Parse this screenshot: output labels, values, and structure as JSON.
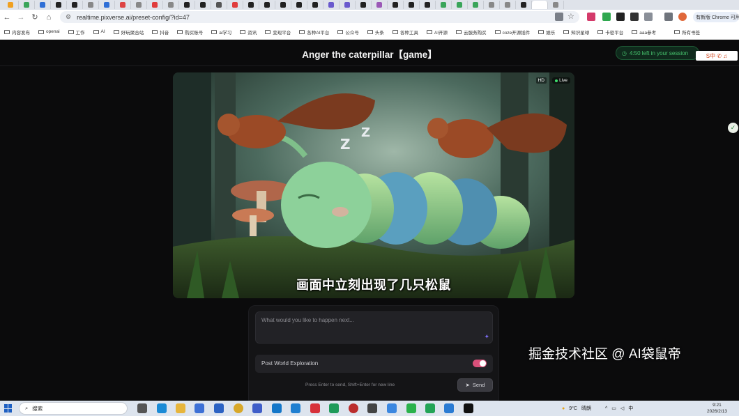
{
  "browser": {
    "url": "realtime.pixverse.ai/preset-config/?id=47",
    "update_button": "有新版 Chrome 可用",
    "bookmarks": [
      "内容发布",
      "openai",
      "工作",
      "AI",
      "好玩聚合站",
      "抖音",
      "购买账号",
      "ai学习",
      "资讯",
      "变现平台",
      "各种AI平台",
      "公众号",
      "头条",
      "各种工具",
      "AI开源",
      "云服务购买",
      "coze开源插件",
      "娱乐",
      "知识星球",
      "卡密平台",
      "aaa参考",
      "所有书签"
    ]
  },
  "app": {
    "title": "Anger the caterpillar【game】",
    "session_text": "4:50 left in your session",
    "ext_label": "S中 ✆ ♫"
  },
  "video": {
    "hd_label": "HD",
    "live_label": "Live",
    "subtitle": "画面中立刻出现了几只松鼠"
  },
  "panel": {
    "prompt_placeholder": "What would you like to happen next...",
    "prompt_value": "",
    "explore_label": "Post World Exploration",
    "explore_enabled": true,
    "hint": "Press Enter to send, Shift+Enter for new line",
    "send_label": "Send"
  },
  "watermark": "掘金技术社区 @ AI袋鼠帝",
  "taskbar": {
    "search_label": "搜索",
    "weather": "9°C",
    "weather_desc": "晴朗",
    "ime": "中",
    "time": "9:21",
    "date": "2026/2/13"
  },
  "colors": {
    "session_green": "#47c46e",
    "toggle_on": "#d9507a",
    "background": "#0b0b0c"
  }
}
